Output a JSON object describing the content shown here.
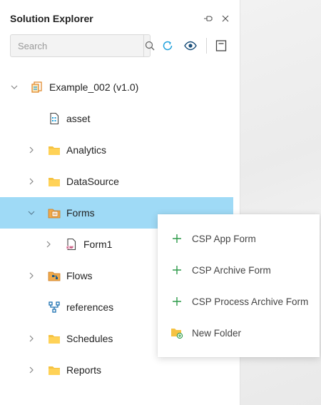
{
  "panel": {
    "title": "Solution Explorer"
  },
  "search": {
    "placeholder": "Search"
  },
  "tree": {
    "root": {
      "label": "Example_002 (v1.0)"
    },
    "items": [
      {
        "label": "asset"
      },
      {
        "label": "Analytics"
      },
      {
        "label": "DataSource"
      },
      {
        "label": "Forms"
      },
      {
        "label": "Form1"
      },
      {
        "label": "Flows"
      },
      {
        "label": "references"
      },
      {
        "label": "Schedules"
      },
      {
        "label": "Reports"
      }
    ]
  },
  "context_menu": {
    "items": [
      {
        "label": "CSP App Form",
        "icon": "plus-icon"
      },
      {
        "label": "CSP Archive Form",
        "icon": "plus-icon"
      },
      {
        "label": "CSP Process Archive Form",
        "icon": "plus-icon"
      },
      {
        "label": "New Folder",
        "icon": "new-folder-icon"
      }
    ]
  },
  "colors": {
    "selection": "#9fdaf6",
    "accent": "#1ea0dc",
    "folder": "#f5c242",
    "plus": "#2e9b4a"
  }
}
